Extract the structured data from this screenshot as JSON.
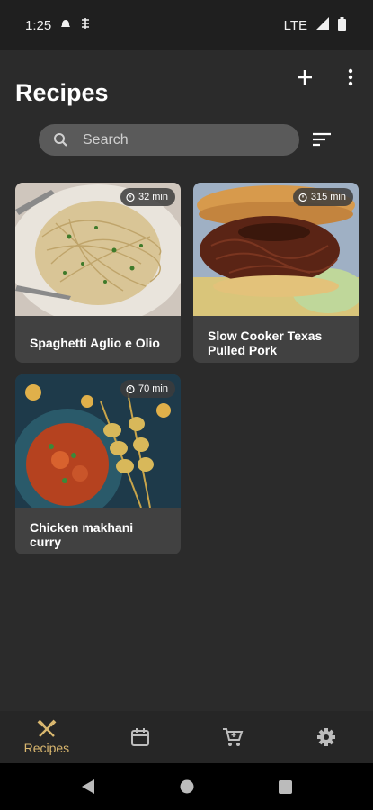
{
  "status_bar": {
    "time": "1:25",
    "network": "LTE",
    "icons": [
      "notification-icon",
      "app-icon",
      "signal-icon",
      "battery-icon"
    ]
  },
  "header": {
    "title": "Recipes",
    "add_icon": "plus-icon",
    "menu_icon": "more-vert-icon"
  },
  "search": {
    "placeholder": "Search",
    "value": "",
    "icon": "search-icon",
    "filter_icon": "sort-icon"
  },
  "recipes": [
    {
      "title": "Spaghetti Aglio e Olio",
      "time": "32 min"
    },
    {
      "title": "Slow Cooker Texas Pulled Pork",
      "time": "315 min"
    },
    {
      "title": "Chicken makhani curry",
      "time": "70 min"
    }
  ],
  "bottom_nav": {
    "items": [
      {
        "label": "Recipes",
        "icon": "utensils-icon",
        "active": true
      },
      {
        "label": "",
        "icon": "calendar-icon",
        "active": false
      },
      {
        "label": "",
        "icon": "cart-icon",
        "active": false
      },
      {
        "label": "",
        "icon": "settings-icon",
        "active": false
      }
    ]
  },
  "colors": {
    "background": "#2b2b2b",
    "card": "#414141",
    "accent": "#d9b76f",
    "search_bg": "#5a5a5a"
  }
}
